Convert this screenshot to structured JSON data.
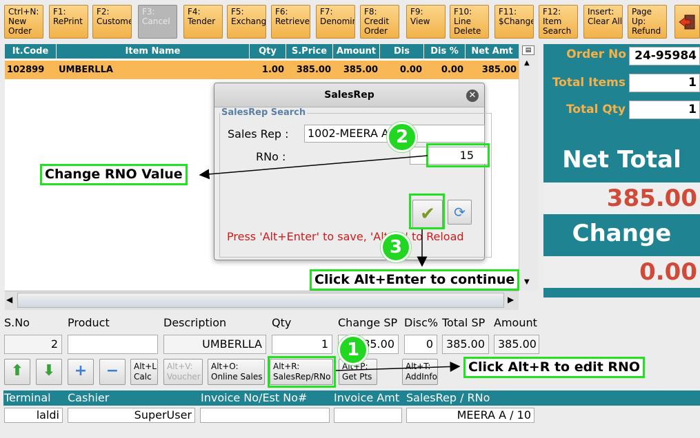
{
  "toolbar": {
    "keys": [
      {
        "label": "Ctrl+N:\nNew\nOrder"
      },
      {
        "label": "F1:\nRePrint"
      },
      {
        "label": "F2:\nCustome"
      },
      {
        "label": "F3:\nCancel"
      },
      {
        "label": "F4:\nTender"
      },
      {
        "label": "F5:\nExchang"
      },
      {
        "label": "F6:\nRetrieve"
      },
      {
        "label": "F7:\nDenomin"
      },
      {
        "label": "F8:\nCredit\nOrder"
      },
      {
        "label": "F9:\nView"
      },
      {
        "label": "F10:\nLine\nDelete"
      },
      {
        "label": "F11:\n$Change"
      },
      {
        "label": "F12:\nItem\nSearch"
      },
      {
        "label": "Insert:\nClear All"
      },
      {
        "label": "Page\nUp:\nRefund"
      }
    ]
  },
  "grid": {
    "columns": [
      "It.Code",
      "Item Name",
      "Qty",
      "S.Price",
      "Amount",
      "Dis Amt",
      "Dis %",
      "Net Amt"
    ],
    "rows": [
      [
        "102899",
        "UMBERLLA",
        "1.00",
        "385.00",
        "385.00",
        "0.00",
        "0.00",
        "385.00"
      ]
    ]
  },
  "summary": {
    "order_no_label": "Order No",
    "order_no": "24-95984",
    "total_items_label": "Total Items",
    "total_items": "1",
    "total_qty_label": "Total Qty",
    "total_qty": "1",
    "net_total_label": "Net Total",
    "net_total": "385.00",
    "change_label": "Change",
    "change": "0.00"
  },
  "entry": {
    "headers": [
      "S.No",
      "Product",
      "Description",
      "Qty",
      "Change SP",
      "Disc%",
      "Total SP",
      "Amount"
    ],
    "sno": "2",
    "product": "",
    "description": "UMBERLLA",
    "qty": "1",
    "change_sp": "385.00",
    "disc": "0",
    "total_sp": "385.00",
    "amount": "385.00"
  },
  "actions": {
    "calc": "Alt+L:\nCalc",
    "voucher": "Alt+V:\nVoucher",
    "online": "Alt+O:\nOnline Sales",
    "salesrep": "Alt+R:\nSalesRep/RNo",
    "getpts": "Alt+P:\nGet Pts",
    "addinfo": "Alt+T:\nAddInfo"
  },
  "status": {
    "terminal_label": "Terminal",
    "cashier_label": "Cashier",
    "invoice_label": "Invoice No/Est No#",
    "amt_label": "Invoice Amt",
    "rep_label": "SalesRep / RNo",
    "terminal": "laldi",
    "cashier": "SuperUser",
    "invoice": "",
    "amt": "",
    "rep": "MEERA A  / 10"
  },
  "dialog": {
    "title": "SalesRep",
    "legend": "SalesRep Search",
    "rep_label": "Sales Rep :",
    "rep_value": "1002-MEERA A",
    "rno_label": "RNo :",
    "rno_value": "15",
    "notice": "Press 'Alt+Enter' to save, 'Alt+R' to Reload"
  },
  "annotations": {
    "step1": "1",
    "step2": "2",
    "step3": "3",
    "change_rno": "Change RNO Value",
    "alt_enter": "Click Alt+Enter to continue",
    "alt_r": "Click Alt+R to edit RNO"
  },
  "colors": {
    "teal": "#1f8391",
    "orange": "#f9b856",
    "green": "#22e022",
    "red": "#d04a3a"
  }
}
